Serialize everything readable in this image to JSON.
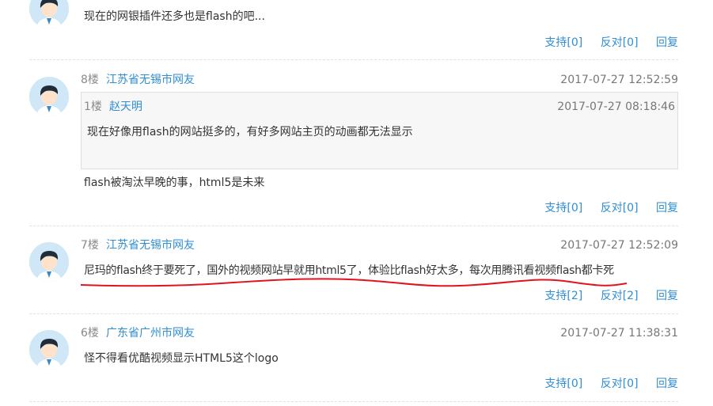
{
  "comments": [
    {
      "text": "现在的网银插件还多也是flash的吧...",
      "support": "支持[0]",
      "oppose": "反对[0]",
      "reply": "回复"
    },
    {
      "floor": "8楼",
      "user": "江苏省无锡市网友",
      "time": "2017-07-27 12:52:59",
      "quote": {
        "floor": "1楼",
        "user": "赵天明",
        "time": "2017-07-27 08:18:46",
        "text": "现在好像用flash的网站挺多的，有好多网站主页的动画都无法显示"
      },
      "text": "flash被淘汰早晚的事，html5是未来",
      "support": "支持[0]",
      "oppose": "反对[0]",
      "reply": "回复"
    },
    {
      "floor": "7楼",
      "user": "江苏省无锡市网友",
      "time": "2017-07-27 12:52:09",
      "text": "尼玛的flash终于要死了，国外的视频网站早就用html5了，体验比flash好太多，每次用腾讯看视频flash都卡死",
      "support": "支持[2]",
      "oppose": "反对[2]",
      "reply": "回复"
    },
    {
      "floor": "6楼",
      "user": "广东省广州市网友",
      "time": "2017-07-27 11:38:31",
      "text": "怪不得看优酷视频显示HTML5这个logo",
      "support": "支持[0]",
      "oppose": "反对[0]",
      "reply": "回复"
    }
  ],
  "colors": {
    "link": "#2f8ed4",
    "annotation": "#e0141e",
    "avatar_bg": "#cfe7f6"
  }
}
